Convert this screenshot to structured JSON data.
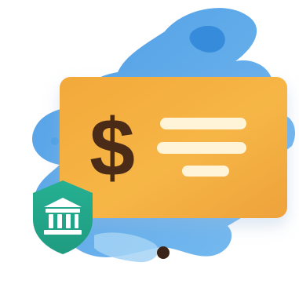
{
  "illustration": {
    "card_symbol": "$",
    "icons": {
      "card": "payment-card-icon",
      "shield": "bank-shield-icon",
      "bank": "bank-building-icon"
    },
    "colors": {
      "card": "#f5b03c",
      "card_dark": "#e99a2a",
      "symbol": "#4a2b17",
      "lines": "#fff3d8",
      "shield": "#23a98c",
      "splash_dark": "#4a9fe6",
      "splash_light": "#8ac8f4",
      "dot": "#3a2418"
    }
  }
}
